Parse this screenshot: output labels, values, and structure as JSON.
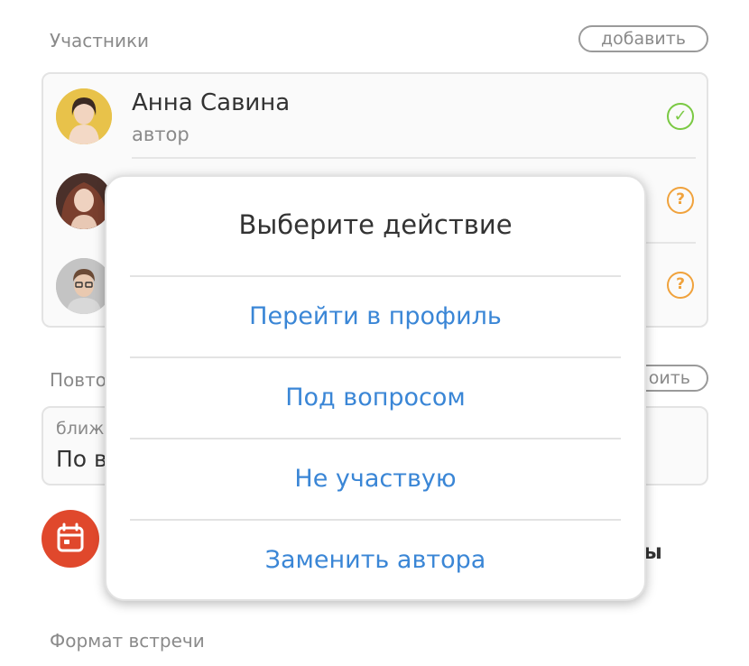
{
  "participants": {
    "label": "Участники",
    "add_label": "добавить",
    "items": [
      {
        "name": "Анна Савина",
        "role": "автор",
        "status": "confirmed"
      },
      {
        "name": "",
        "role": "",
        "status": "question"
      },
      {
        "name": "",
        "role": "",
        "status": "question"
      }
    ]
  },
  "repeat": {
    "label": "Повто",
    "button_label": "оить",
    "sub": "ближ",
    "value": "По в"
  },
  "calendar": {
    "trailing_text": "ы"
  },
  "format": {
    "label": "Формат встречи"
  },
  "dialog": {
    "title": "Выберите действие",
    "actions": [
      {
        "label": "Перейти в профиль"
      },
      {
        "label": "Под вопросом"
      },
      {
        "label": "Не участвую"
      },
      {
        "label": "Заменить автора"
      }
    ]
  },
  "icons": {
    "confirmed": "check-circle-icon",
    "question": "question-circle-icon",
    "calendar": "calendar-icon"
  },
  "colors": {
    "accent_blue": "#3a86d6",
    "confirm_green": "#7ac943",
    "question_orange": "#f0a23c",
    "calendar_red": "#e0482c"
  }
}
